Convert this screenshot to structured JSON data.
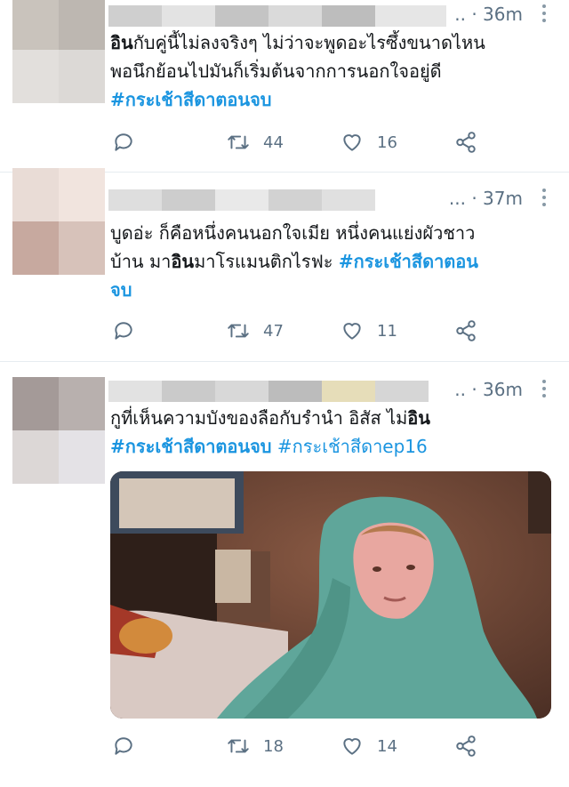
{
  "tweets": [
    {
      "time": "· 36m",
      "ellipsis": "..",
      "text_lead": "อิน",
      "text_rest": "กับคู่นี้ไม่ลงจริงๆ ไม่ว่าจะพูดอะไรซึ้งขนาดไหน\nพอนึกย้อนไปมันก็เริ่มต้นจากการนอกใจอยู่ดี\n",
      "hashtag": "#กระเช้าสีดาตอนจบ",
      "actions": {
        "retweets": "44",
        "likes": "16"
      }
    },
    {
      "time": "· 37m",
      "ellipsis": "...",
      "text_a": "บูดอ่ะ ก็คือหนึ่งคนนอกใจเมีย หนึ่งคนแย่งผัวชาว\nบ้าน มา",
      "text_bold": "อิน",
      "text_b": "มาโรแมนติกไรฟะ ",
      "hashtag": "#กระเช้าสีดาตอน\nจบ",
      "actions": {
        "retweets": "47",
        "likes": "11"
      }
    },
    {
      "time": "· 36m",
      "ellipsis": "..",
      "text_a": "กูที่เห็นความบังของลือกับรำนำ อิสัส ไม่",
      "text_bold": "อิน",
      "hashtag": "#กระเช้าสีดาตอนจบ",
      "hashtag2": "#กระเช้าสีดาep16",
      "media_icon": "gif-child-in-blanket-image",
      "actions": {
        "retweets": "18",
        "likes": "14"
      }
    }
  ],
  "colors": {
    "link": "#1b95e0",
    "muted": "#5b7083",
    "divider": "#e6ecf0"
  },
  "icons": {
    "reply": "reply-icon",
    "retweet": "retweet-icon",
    "like": "like-icon",
    "share": "share-icon",
    "more": "more-icon"
  }
}
